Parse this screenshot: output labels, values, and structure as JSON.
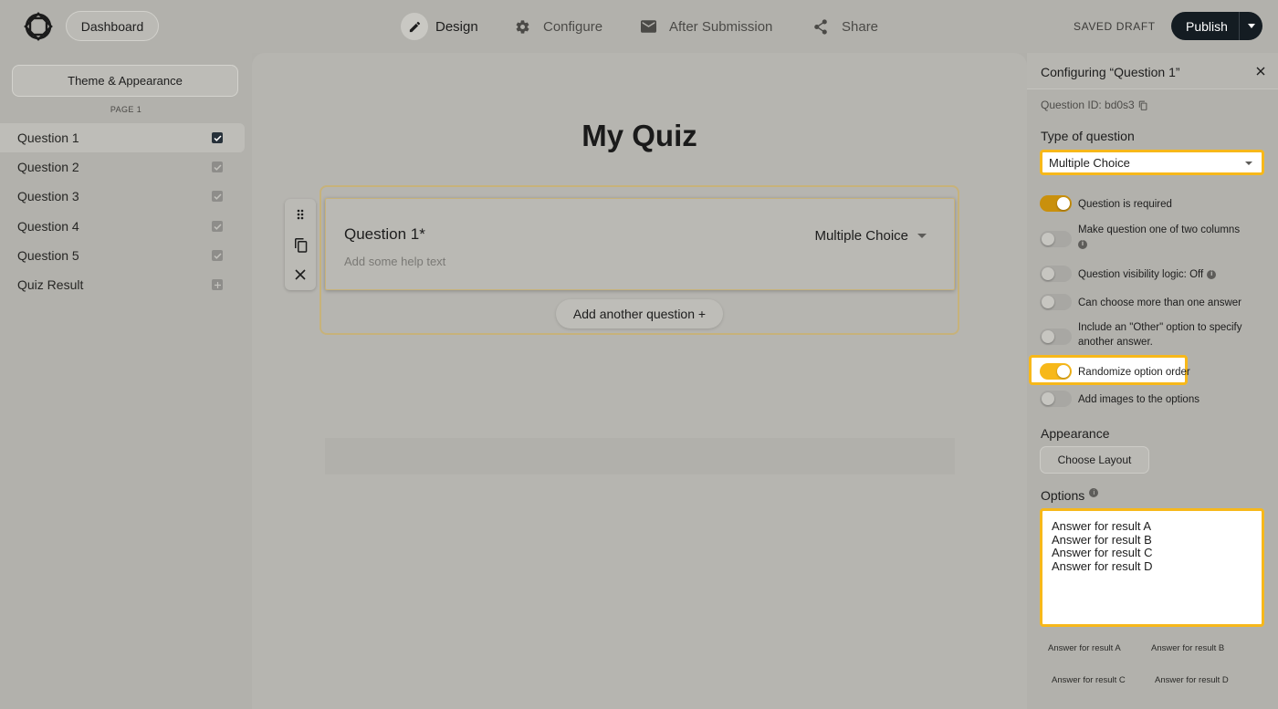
{
  "topbar": {
    "dashboard_label": "Dashboard",
    "nav": [
      {
        "label": "Design",
        "icon": "pencil-icon",
        "active": true
      },
      {
        "label": "Configure",
        "icon": "gear-icon",
        "active": false
      },
      {
        "label": "After Submission",
        "icon": "envelope-icon",
        "active": false
      },
      {
        "label": "Share",
        "icon": "share-icon",
        "active": false
      }
    ],
    "saved_status": "SAVED DRAFT",
    "publish_label": "Publish"
  },
  "sidebar": {
    "theme_button": "Theme & Appearance",
    "page_label": "PAGE 1",
    "items": [
      {
        "label": "Question 1",
        "selected": true
      },
      {
        "label": "Question 2"
      },
      {
        "label": "Question 3"
      },
      {
        "label": "Question 4"
      },
      {
        "label": "Question 5"
      },
      {
        "label": "Quiz Result"
      }
    ]
  },
  "canvas": {
    "quiz_title": "My Quiz",
    "question_title": "Question 1*",
    "help_placeholder": "Add some help text",
    "question_type": "Multiple Choice",
    "add_question_label": "Add another question +"
  },
  "panel": {
    "title": "Configuring “Question 1”",
    "question_id": "Question ID: bd0s3",
    "type_label": "Type of question",
    "type_value": "Multiple Choice",
    "toggles": [
      {
        "label": "Question is required",
        "on": true
      },
      {
        "label": "Make question one of two columns",
        "on": false
      },
      {
        "label": "Question visibility logic: Off",
        "on": false
      },
      {
        "label": "Can choose more than one answer",
        "on": false
      },
      {
        "label": "Include an \"Other\" option to specify another answer.",
        "on": false
      },
      {
        "label": "Randomize option order",
        "on": true
      },
      {
        "label": "Add images to the options",
        "on": false
      }
    ],
    "appearance_label": "Appearance",
    "choose_layout_label": "Choose Layout",
    "options_label": "Options",
    "options_text": "Answer for result A\nAnswer for result B\nAnswer for result C\nAnswer for result D",
    "option_chips": [
      "Answer for result A",
      "Answer for result B",
      "Answer for result C",
      "Answer for result D"
    ]
  },
  "colors": {
    "accent": "#f7b81a",
    "toggle_on": "#c9900d",
    "publish_bg": "#141c22"
  }
}
